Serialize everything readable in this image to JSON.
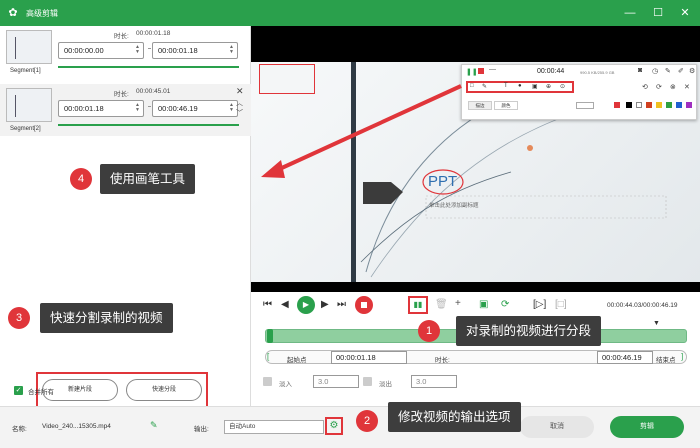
{
  "window": {
    "title": "高级剪辑"
  },
  "segments": [
    {
      "name": "Segment[1]",
      "duration_label": "时长:",
      "duration": "00:00:01.18",
      "start": "00:00:00.00",
      "end": "00:00:01.18"
    },
    {
      "name": "Segment[2]",
      "duration_label": "时长:",
      "duration": "00:00:45.01",
      "start": "00:00:01.18",
      "end": "00:00:46.19"
    }
  ],
  "annotations": {
    "a1": {
      "num": "1",
      "text": "对录制的视频进行分段"
    },
    "a2": {
      "num": "2",
      "text": "修改视频的输出选项"
    },
    "a3": {
      "num": "3",
      "text": "快速分割录制的视频"
    },
    "a4": {
      "num": "4",
      "text": "使用画笔工具"
    }
  },
  "left_buttons": {
    "new_segment": "新建片段",
    "quick_split": "快速分段"
  },
  "merge_all": "合并所有",
  "preview": {
    "ppt_text": "PPT",
    "subtitle_placeholder": "单击此处添加副标题",
    "rec_time": "00:00:44",
    "rec_info": "990.5 KB/255.9 GB",
    "pen_tabs": [
      "描边",
      "颜色"
    ]
  },
  "playback": {
    "time": "00:00:44.03/00:00:46.19"
  },
  "range": {
    "start_label": "起始点",
    "start": "00:00:01.18",
    "duration_label": "时长:",
    "end": "00:00:46.19",
    "end_label": "结束点"
  },
  "fade": {
    "in_label": "淡入",
    "in_value": "3.0",
    "out_label": "淡出",
    "out_value": "3.0"
  },
  "bottom": {
    "name_label": "名称:",
    "filename": "Video_240...15305.mp4",
    "output_label": "输出:",
    "output_value": "自动Auto",
    "cancel": "取消",
    "edit": "剪辑"
  },
  "colors": {
    "brand": "#2aa04c",
    "annotation": "#3d3d3d",
    "badge": "#e0353a"
  }
}
